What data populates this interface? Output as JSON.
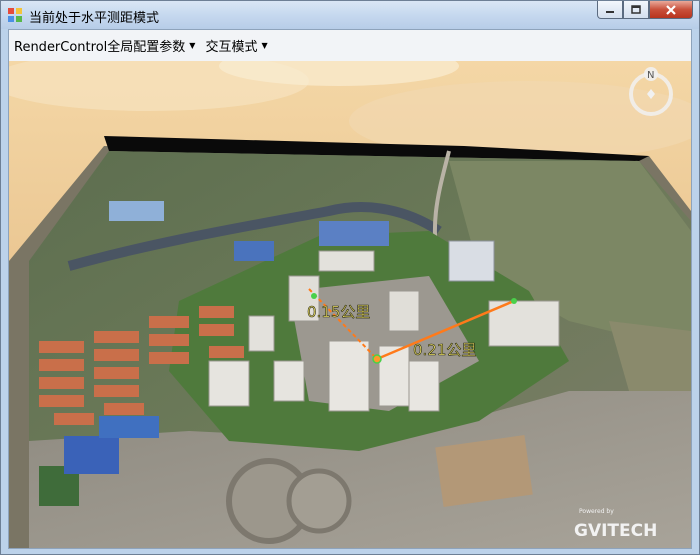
{
  "window": {
    "title": "当前处于水平测距模式"
  },
  "menu": {
    "items": [
      {
        "label": "RenderControl全局配置参数"
      },
      {
        "label": "交互模式"
      }
    ]
  },
  "scene": {
    "measurements": [
      {
        "label": "0.15公里"
      },
      {
        "label": "0.21公里"
      }
    ],
    "compass_label": "N",
    "watermark": {
      "small": "Powered by",
      "brand": "GVITECH"
    }
  },
  "colors": {
    "measure_text": "#f3e56a",
    "measure_line": "#ff7a1a",
    "title_bar": "#c4d7ee"
  }
}
